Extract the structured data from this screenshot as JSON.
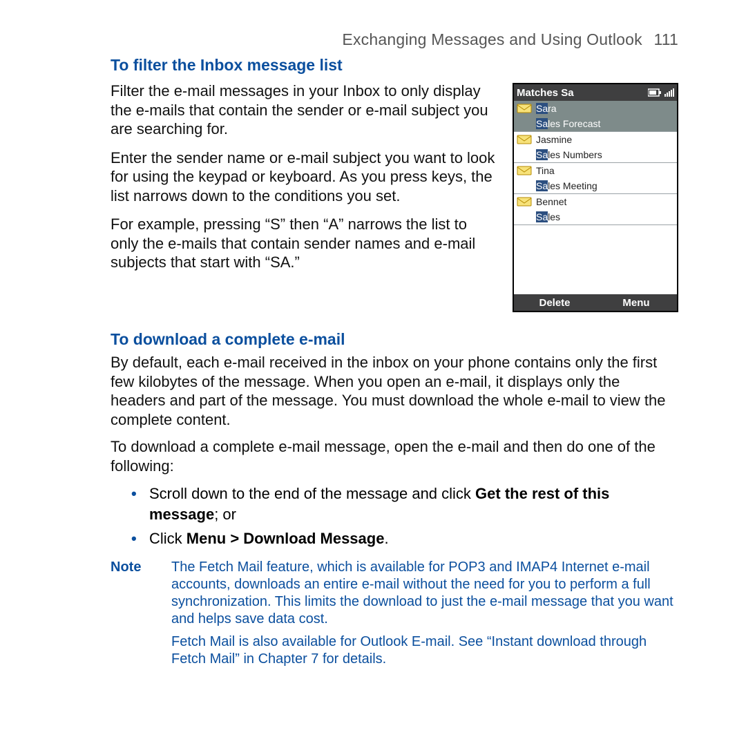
{
  "header": {
    "title": "Exchanging Messages and Using Outlook",
    "page": "111"
  },
  "section1": {
    "heading": "To filter the Inbox message list",
    "p1": "Filter the e-mail messages in your Inbox to only display the e-mails that contain the sender or e-mail subject you are searching for.",
    "p2": "Enter the sender name or e-mail subject you want to look for using the keypad or keyboard. As you press keys, the list narrows down to the conditions you set.",
    "p3": "For example, pressing “S” then “A” narrows the list to only the e-mails that contain sender names and e-mail subjects that start with “SA.”"
  },
  "phone": {
    "title": "Matches Sa",
    "items": [
      {
        "sender_hl": "Sa",
        "sender_rest": "ra",
        "subj_hl": "Sa",
        "subj_rest": "les Forecast",
        "selected": true
      },
      {
        "sender_hl": "",
        "sender_rest": "Jasmine",
        "subj_hl": "Sa",
        "subj_rest": "les Numbers",
        "selected": false
      },
      {
        "sender_hl": "",
        "sender_rest": "Tina",
        "subj_hl": "Sa",
        "subj_rest": "les Meeting",
        "selected": false
      },
      {
        "sender_hl": "",
        "sender_rest": "Bennet",
        "subj_hl": "Sa",
        "subj_rest": "les",
        "selected": false
      }
    ],
    "soft_left": "Delete",
    "soft_right": "Menu"
  },
  "section2": {
    "heading": "To download a complete e-mail",
    "p1": "By default, each e-mail received in the inbox on your phone contains only the first few kilobytes of the message. When you open an e-mail, it displays only the headers and part of the message. You must download the whole e-mail to view the complete content.",
    "p2": "To download a complete e-mail message, open the e-mail and then do one of the following:",
    "b1_pre": "Scroll down to the end of the message and click ",
    "b1_bold": "Get the rest of this message",
    "b1_post": "; or",
    "b2_pre": "Click ",
    "b2_bold": "Menu > Download Message",
    "b2_post": "."
  },
  "note": {
    "label": "Note",
    "p1": "The Fetch Mail feature, which is available for POP3 and IMAP4 Internet e-mail accounts, downloads an entire e-mail without the need for you to perform a full synchronization. This limits the download to just the e-mail message that you want and helps save data cost.",
    "p2": "Fetch Mail is also available for Outlook E-mail. See “Instant download through Fetch Mail” in Chapter 7 for details."
  }
}
